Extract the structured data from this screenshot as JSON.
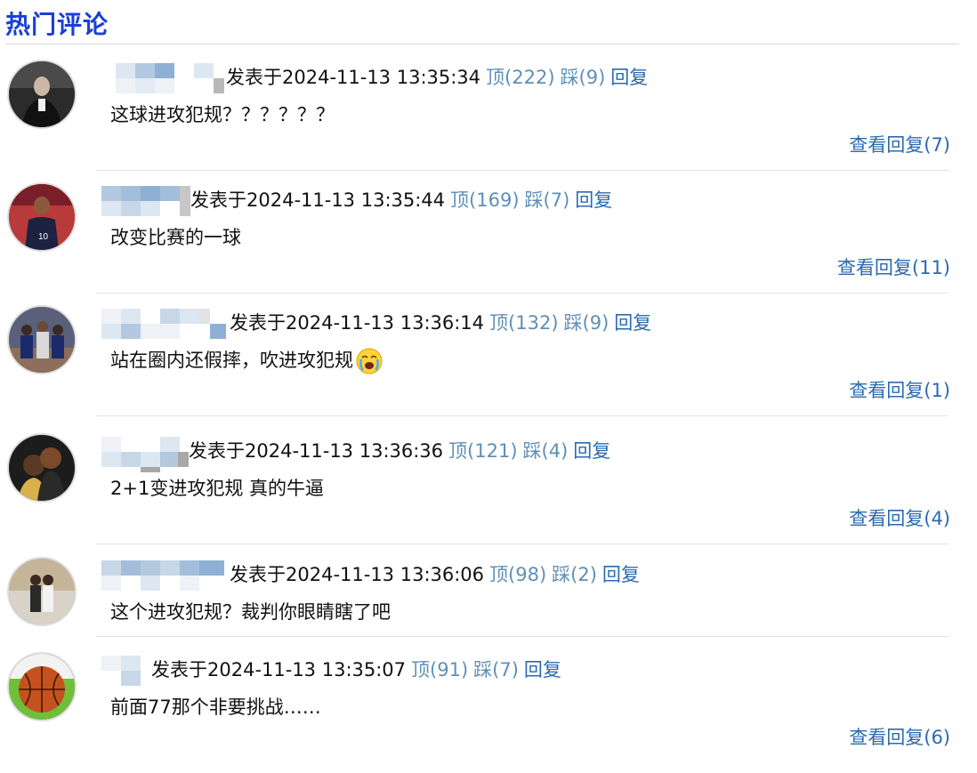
{
  "section": {
    "title": "热门评论"
  },
  "comments": [
    {
      "posted_label": "发表于2024-11-13 13:35:34",
      "up": "顶(222)",
      "down": "踩(9)",
      "reply": "回复",
      "content": "这球进攻犯规？？？？？？",
      "view_replies": "查看回复(7)",
      "avatar": "man-in-suit-avatar"
    },
    {
      "posted_label": "发表于2024-11-13 13:35:44",
      "up": "顶(169)",
      "down": "踩(7)",
      "reply": "回复",
      "content": "改变比赛的一球",
      "view_replies": "查看回复(11)",
      "avatar": "basketball-player-avatar"
    },
    {
      "posted_label": "发表于2024-11-13 13:36:14",
      "up": "顶(132)",
      "down": "踩(9)",
      "reply": "回复",
      "content": "站在圈内还假摔，吹进攻犯规",
      "view_replies": "查看回复(1)",
      "avatar": "team-huddle-avatar",
      "emoji": "crying-face-emoji"
    },
    {
      "posted_label": "发表于2024-11-13 13:36:36",
      "up": "顶(121)",
      "down": "踩(4)",
      "reply": "回复",
      "content": "2+1变进攻犯规 真的牛逼",
      "view_replies": "查看回复(4)",
      "avatar": "two-people-avatar"
    },
    {
      "posted_label": "发表于2024-11-13 13:36:06",
      "up": "顶(98)",
      "down": "踩(2)",
      "reply": "回复",
      "content": "这个进攻犯规？裁判你眼睛瞎了吧",
      "view_replies": "",
      "avatar": "couple-standing-avatar"
    },
    {
      "posted_label": "发表于2024-11-13 13:35:07",
      "up": "顶(91)",
      "down": "踩(7)",
      "reply": "回复",
      "content": "前面77那个非要挑战……",
      "view_replies": "查看回复(6)",
      "avatar": "basketball-avatar"
    }
  ],
  "colors": {
    "title": "#1a3fd8",
    "vote": "#5f8fb7",
    "link": "#2a6ab0"
  }
}
